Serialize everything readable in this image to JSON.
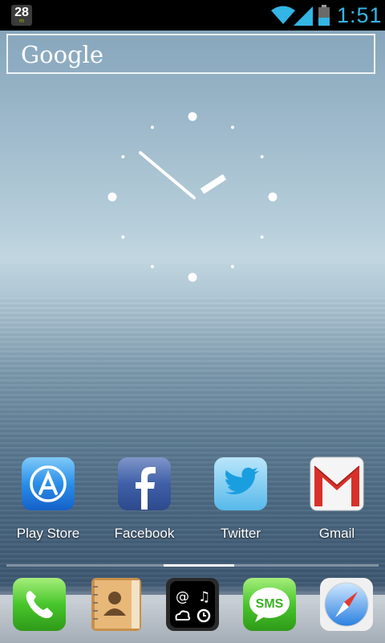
{
  "status_bar": {
    "notification_value": "28",
    "notification_sub": "m",
    "time": "1:51",
    "icons": [
      "wifi-icon",
      "signal-icon",
      "battery-icon"
    ],
    "accent_color": "#33b5e5"
  },
  "search_widget": {
    "logo_text": "Google"
  },
  "clock_widget": {
    "type": "analog",
    "hour": 1,
    "minute": 51
  },
  "apps": [
    {
      "label": "Play Store",
      "icon": "app-store-icon"
    },
    {
      "label": "Facebook",
      "icon": "facebook-icon"
    },
    {
      "label": "Twitter",
      "icon": "twitter-bird-icon"
    },
    {
      "label": "Gmail",
      "icon": "gmail-envelope-icon"
    }
  ],
  "dock": {
    "items": [
      {
        "icon": "phone-icon"
      },
      {
        "icon": "contacts-book-icon"
      },
      {
        "icon": "utilities-icon",
        "glyph_at": "@"
      },
      {
        "icon": "sms-icon",
        "text": "SMS"
      },
      {
        "icon": "safari-compass-icon"
      }
    ]
  },
  "pager": {
    "page_count": 5,
    "current_page": 3
  }
}
